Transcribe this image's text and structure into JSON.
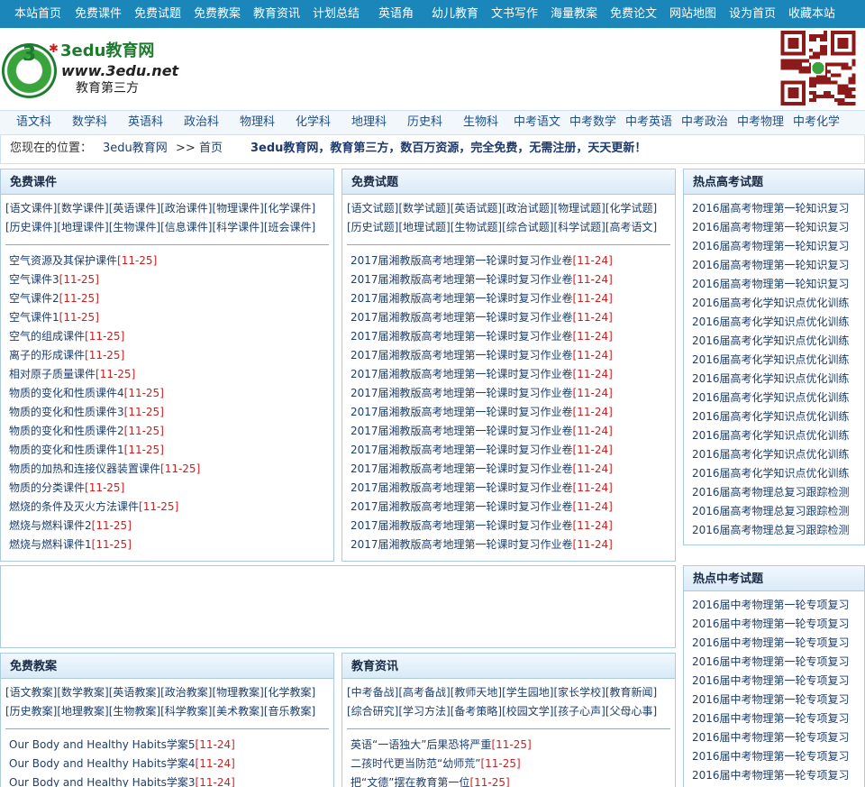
{
  "topnav": [
    "本站首页",
    "免费课件",
    "免费试题",
    "免费教案",
    "教育资讯",
    "计划总结",
    "英语角",
    "幼儿教育",
    "文书写作",
    "海量教案",
    "免费论文",
    "网站地图",
    "设为首页",
    "收藏本站"
  ],
  "logo": {
    "badge": "3",
    "brand": "3edu教育网",
    "url": "www.3edu.net",
    "tagline": "教育第三方"
  },
  "subjects": [
    "语文科",
    "数学科",
    "英语科",
    "政治科",
    "物理科",
    "化学科",
    "地理科",
    "历史科",
    "生物科",
    "中考语文",
    "中考数学",
    "中考英语",
    "中考政治",
    "中考物理",
    "中考化学"
  ],
  "location": {
    "label": "您现在的位置：",
    "site": "3edu教育网",
    "sep": ">>",
    "page": "首页",
    "slogan": "3edu教育网，教育第三方，数百万资源，完全免费，无需注册，天天更新！"
  },
  "courseware": {
    "title": "免费课件",
    "cats1": [
      "[语文课件]",
      "[数学课件]",
      "[英语课件]",
      "[政治课件]",
      "[物理课件]",
      "[化学课件]"
    ],
    "cats2": [
      "[历史课件]",
      "[地理课件]",
      "[生物课件]",
      "[信息课件]",
      "[科学课件]",
      "[班会课件]"
    ],
    "items": [
      {
        "t": "空气资源及其保护课件",
        "d": "[11-25]"
      },
      {
        "t": "空气课件3",
        "d": "[11-25]"
      },
      {
        "t": "空气课件2",
        "d": "[11-25]"
      },
      {
        "t": "空气课件1",
        "d": "[11-25]"
      },
      {
        "t": "空气的组成课件",
        "d": "[11-25]"
      },
      {
        "t": "离子的形成课件",
        "d": "[11-25]"
      },
      {
        "t": "相对原子质量课件",
        "d": "[11-25]"
      },
      {
        "t": "物质的变化和性质课件4",
        "d": "[11-25]"
      },
      {
        "t": "物质的变化和性质课件3",
        "d": "[11-25]"
      },
      {
        "t": "物质的变化和性质课件2",
        "d": "[11-25]"
      },
      {
        "t": "物质的变化和性质课件1",
        "d": "[11-25]"
      },
      {
        "t": "物质的加热和连接仪器装置课件",
        "d": "[11-25]"
      },
      {
        "t": "物质的分类课件",
        "d": "[11-25]"
      },
      {
        "t": "燃烧的条件及灭火方法课件",
        "d": "[11-25]"
      },
      {
        "t": "燃烧与燃料课件2",
        "d": "[11-25]"
      },
      {
        "t": "燃烧与燃料课件1",
        "d": "[11-25]"
      }
    ]
  },
  "tests": {
    "title": "免费试题",
    "cats1": [
      "[语文试题]",
      "[数学试题]",
      "[英语试题]",
      "[政治试题]",
      "[物理试题]",
      "[化学试题]"
    ],
    "cats2": [
      "[历史试题]",
      "[地理试题]",
      "[生物试题]",
      "[综合试题]",
      "[科学试题]",
      "[高考语文]"
    ],
    "items": [
      {
        "t": "2017届湘教版高考地理第一轮课时复习作业卷",
        "d": "[11-24]"
      },
      {
        "t": "2017届湘教版高考地理第一轮课时复习作业卷",
        "d": "[11-24]"
      },
      {
        "t": "2017届湘教版高考地理第一轮课时复习作业卷",
        "d": "[11-24]"
      },
      {
        "t": "2017届湘教版高考地理第一轮课时复习作业卷",
        "d": "[11-24]"
      },
      {
        "t": "2017届湘教版高考地理第一轮课时复习作业卷",
        "d": "[11-24]"
      },
      {
        "t": "2017届湘教版高考地理第一轮课时复习作业卷",
        "d": "[11-24]"
      },
      {
        "t": "2017届湘教版高考地理第一轮课时复习作业卷",
        "d": "[11-24]"
      },
      {
        "t": "2017届湘教版高考地理第一轮课时复习作业卷",
        "d": "[11-24]"
      },
      {
        "t": "2017届湘教版高考地理第一轮课时复习作业卷",
        "d": "[11-24]"
      },
      {
        "t": "2017届湘教版高考地理第一轮课时复习作业卷",
        "d": "[11-24]"
      },
      {
        "t": "2017届湘教版高考地理第一轮课时复习作业卷",
        "d": "[11-24]"
      },
      {
        "t": "2017届湘教版高考地理第一轮课时复习作业卷",
        "d": "[11-24]"
      },
      {
        "t": "2017届湘教版高考地理第一轮课时复习作业卷",
        "d": "[11-24]"
      },
      {
        "t": "2017届湘教版高考地理第一轮课时复习作业卷",
        "d": "[11-24]"
      },
      {
        "t": "2017届湘教版高考地理第一轮课时复习作业卷",
        "d": "[11-24]"
      },
      {
        "t": "2017届湘教版高考地理第一轮课时复习作业卷",
        "d": "[11-24]"
      }
    ]
  },
  "hot_gaokao": {
    "title": "热点高考试题",
    "items": [
      "2016届高考物理第一轮知识复习",
      "2016届高考物理第一轮知识复习",
      "2016届高考物理第一轮知识复习",
      "2016届高考物理第一轮知识复习",
      "2016届高考物理第一轮知识复习",
      "2016届高考化学知识点优化训练",
      "2016届高考化学知识点优化训练",
      "2016届高考化学知识点优化训练",
      "2016届高考化学知识点优化训练",
      "2016届高考化学知识点优化训练",
      "2016届高考化学知识点优化训练",
      "2016届高考化学知识点优化训练",
      "2016届高考化学知识点优化训练",
      "2016届高考化学知识点优化训练",
      "2016届高考化学知识点优化训练",
      "2016届高考物理总复习跟踪检测",
      "2016届高考物理总复习跟踪检测",
      "2016届高考物理总复习跟踪检测"
    ]
  },
  "hot_zhongkao": {
    "title": "热点中考试题",
    "items": [
      "2016届中考物理第一轮专项复习",
      "2016届中考物理第一轮专项复习",
      "2016届中考物理第一轮专项复习",
      "2016届中考物理第一轮专项复习",
      "2016届中考物理第一轮专项复习",
      "2016届中考物理第一轮专项复习",
      "2016届中考物理第一轮专项复习",
      "2016届中考物理第一轮专项复习",
      "2016届中考物理第一轮专项复习",
      "2016届中考物理第一轮专项复习",
      "2016届中考物理第一轮专项复习"
    ]
  },
  "lessons": {
    "title": "免费教案",
    "cats1": [
      "[语文教案]",
      "[数学教案]",
      "[英语教案]",
      "[政治教案]",
      "[物理教案]",
      "[化学教案]"
    ],
    "cats2": [
      "[历史教案]",
      "[地理教案]",
      "[生物教案]",
      "[科学教案]",
      "[美术教案]",
      "[音乐教案]"
    ],
    "items": [
      {
        "t": "Our Body and Healthy Habits学案5",
        "d": "[11-24]"
      },
      {
        "t": "Our Body and Healthy Habits学案4",
        "d": "[11-24]"
      },
      {
        "t": "Our Body and Healthy Habits学案3",
        "d": "[11-24]"
      }
    ]
  },
  "news": {
    "title": "教育资讯",
    "cats1": [
      "[中考备战]",
      "[高考备战]",
      "[教师天地]",
      "[学生园地]",
      "[家长学校]",
      "[教育新闻]"
    ],
    "cats2": [
      "[综合研究]",
      "[学习方法]",
      "[备考策略]",
      "[校园文学]",
      "[孩子心声]",
      "[父母心事]"
    ],
    "items": [
      {
        "t": "英语“一语独大”后果恐将严重",
        "d": "[11-25]"
      },
      {
        "t": "二孩时代更当防范“幼师荒”",
        "d": "[11-25]"
      },
      {
        "t": "把“文德”摆在教育第一位",
        "d": "[11-25]"
      }
    ]
  },
  "colors": {
    "topnav_bg": "#1a86b9",
    "date_red": "#d01e1e",
    "link": "#1d3f6e",
    "brand_green": "#1e7a2f"
  }
}
